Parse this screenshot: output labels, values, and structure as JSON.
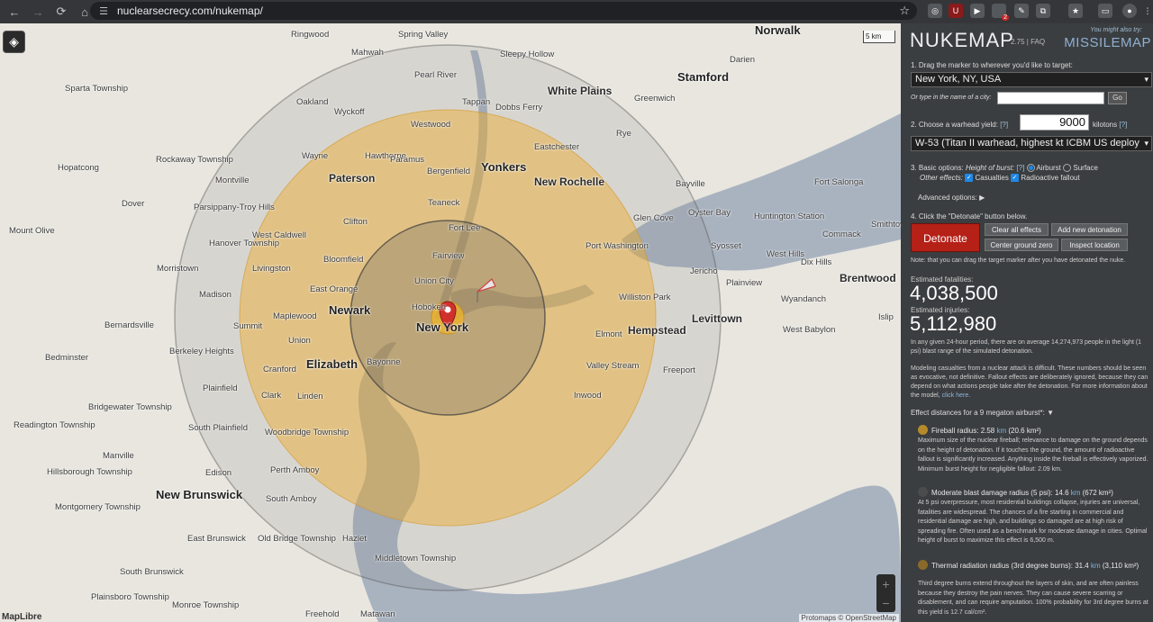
{
  "browser": {
    "url": "nuclearsecrecy.com/nukemap/",
    "ext_badge": "2"
  },
  "map": {
    "scale_label": "5 km",
    "logo": "MapLibre",
    "attribution": "Protomaps © OpenStreetMap",
    "zoom_in": "+",
    "zoom_out": "−",
    "places": [
      {
        "name": "Norwalk",
        "cls": "big"
      },
      {
        "name": "Stamford",
        "cls": "big"
      },
      {
        "name": "White Plains",
        "cls": "mid"
      },
      {
        "name": "Yonkers",
        "cls": "big"
      },
      {
        "name": "New Rochelle",
        "cls": "mid"
      },
      {
        "name": "Paterson",
        "cls": "mid"
      },
      {
        "name": "Newark",
        "cls": "big"
      },
      {
        "name": "New York",
        "cls": "big"
      },
      {
        "name": "Elizabeth",
        "cls": "big"
      },
      {
        "name": "Hempstead",
        "cls": "mid"
      },
      {
        "name": "Levittown",
        "cls": "mid"
      },
      {
        "name": "Brentwood",
        "cls": "mid"
      },
      {
        "name": "New Brunswick",
        "cls": "big"
      },
      {
        "name": "Ringwood",
        "cls": ""
      },
      {
        "name": "Spring Valley",
        "cls": ""
      },
      {
        "name": "Mahwah",
        "cls": ""
      },
      {
        "name": "Sleepy Hollow",
        "cls": ""
      },
      {
        "name": "Pearl River",
        "cls": ""
      },
      {
        "name": "Darien",
        "cls": ""
      },
      {
        "name": "Sparta Township",
        "cls": ""
      },
      {
        "name": "Oakland",
        "cls": ""
      },
      {
        "name": "Tappan",
        "cls": ""
      },
      {
        "name": "Greenwich",
        "cls": ""
      },
      {
        "name": "Wyckoff",
        "cls": ""
      },
      {
        "name": "Dobbs Ferry",
        "cls": ""
      },
      {
        "name": "Westwood",
        "cls": ""
      },
      {
        "name": "Rye",
        "cls": ""
      },
      {
        "name": "Hawthorne",
        "cls": ""
      },
      {
        "name": "Eastchester",
        "cls": ""
      },
      {
        "name": "Wayne",
        "cls": ""
      },
      {
        "name": "Paramus",
        "cls": ""
      },
      {
        "name": "Rockaway Township",
        "cls": ""
      },
      {
        "name": "Hopatcong",
        "cls": ""
      },
      {
        "name": "Bergenfield",
        "cls": ""
      },
      {
        "name": "Bayville",
        "cls": ""
      },
      {
        "name": "Montville",
        "cls": ""
      },
      {
        "name": "Fort Salonga",
        "cls": ""
      },
      {
        "name": "Dover",
        "cls": ""
      },
      {
        "name": "Teaneck",
        "cls": ""
      },
      {
        "name": "Parsippany-Troy Hills",
        "cls": ""
      },
      {
        "name": "Glen Cove",
        "cls": ""
      },
      {
        "name": "Oyster Bay",
        "cls": ""
      },
      {
        "name": "Huntington Station",
        "cls": ""
      },
      {
        "name": "Smithtown",
        "cls": ""
      },
      {
        "name": "Clifton",
        "cls": ""
      },
      {
        "name": "Fort Lee",
        "cls": ""
      },
      {
        "name": "Mount Olive",
        "cls": ""
      },
      {
        "name": "Hanover Township",
        "cls": ""
      },
      {
        "name": "West Caldwell",
        "cls": ""
      },
      {
        "name": "Commack",
        "cls": ""
      },
      {
        "name": "Port Washington",
        "cls": ""
      },
      {
        "name": "Syosset",
        "cls": ""
      },
      {
        "name": "West Hills",
        "cls": ""
      },
      {
        "name": "Fairview",
        "cls": ""
      },
      {
        "name": "Bloomfield",
        "cls": ""
      },
      {
        "name": "Dix Hills",
        "cls": ""
      },
      {
        "name": "Livingston",
        "cls": ""
      },
      {
        "name": "Jericho",
        "cls": ""
      },
      {
        "name": "Morristown",
        "cls": ""
      },
      {
        "name": "Union City",
        "cls": ""
      },
      {
        "name": "Plainview",
        "cls": ""
      },
      {
        "name": "East Orange",
        "cls": ""
      },
      {
        "name": "Madison",
        "cls": ""
      },
      {
        "name": "Williston Park",
        "cls": ""
      },
      {
        "name": "Wyandanch",
        "cls": ""
      },
      {
        "name": "Hoboken",
        "cls": ""
      },
      {
        "name": "Maplewood",
        "cls": ""
      },
      {
        "name": "Islip",
        "cls": ""
      },
      {
        "name": "Bernardsville",
        "cls": ""
      },
      {
        "name": "Summit",
        "cls": ""
      },
      {
        "name": "Elmont",
        "cls": ""
      },
      {
        "name": "West Babylon",
        "cls": ""
      },
      {
        "name": "Union",
        "cls": ""
      },
      {
        "name": "Berkeley Heights",
        "cls": ""
      },
      {
        "name": "Bedminster",
        "cls": ""
      },
      {
        "name": "Bayonne",
        "cls": ""
      },
      {
        "name": "Valley Stream",
        "cls": ""
      },
      {
        "name": "Freeport",
        "cls": ""
      },
      {
        "name": "Cranford",
        "cls": ""
      },
      {
        "name": "Plainfield",
        "cls": ""
      },
      {
        "name": "Clark",
        "cls": ""
      },
      {
        "name": "Linden",
        "cls": ""
      },
      {
        "name": "Inwood",
        "cls": ""
      },
      {
        "name": "Bridgewater Township",
        "cls": ""
      },
      {
        "name": "Readington Township",
        "cls": ""
      },
      {
        "name": "South Plainfield",
        "cls": ""
      },
      {
        "name": "Woodbridge Township",
        "cls": ""
      },
      {
        "name": "Manville",
        "cls": ""
      },
      {
        "name": "Edison",
        "cls": ""
      },
      {
        "name": "Perth Amboy",
        "cls": ""
      },
      {
        "name": "Hillsborough Township",
        "cls": ""
      },
      {
        "name": "South Amboy",
        "cls": ""
      },
      {
        "name": "Montgomery Township",
        "cls": ""
      },
      {
        "name": "East Brunswick",
        "cls": ""
      },
      {
        "name": "Old Bridge Township",
        "cls": ""
      },
      {
        "name": "Hazlet",
        "cls": ""
      },
      {
        "name": "Middletown Township",
        "cls": ""
      },
      {
        "name": "South Brunswick",
        "cls": ""
      },
      {
        "name": "Plainsboro Township",
        "cls": ""
      },
      {
        "name": "Monroe Township",
        "cls": ""
      },
      {
        "name": "Freehold",
        "cls": ""
      },
      {
        "name": "Matawan",
        "cls": ""
      }
    ]
  },
  "panel": {
    "title": "NUKEMAP",
    "version": "2.75 | FAQ",
    "you_might": "You might also try:",
    "missilemap": "MISSILEMAP",
    "step1": "1. Drag the marker to wherever you'd like to target:",
    "city_value": "New York, NY, USA",
    "or_type": "Or type in the name of a city:",
    "go_label": "Go",
    "step2": "2. Choose a warhead yield:",
    "help": "[?]",
    "yield_value": "9000",
    "yield_unit": "kilotons",
    "warhead_value": "W-53 (Titan II warhead, highest kt ICBM US deploy",
    "step3": "3. Basic options:",
    "height_of_burst": "Height of burst:",
    "airburst": "Airburst",
    "surface": "Surface",
    "other_effects": "Other effects:",
    "casualties": "Casualties",
    "fallout": "Radioactive fallout",
    "advanced": "Advanced options:",
    "step4": "4. Click the \"Detonate\" button below.",
    "detonate": "Detonate",
    "clear_effects": "Clear all effects",
    "add_detonation": "Add new detonation",
    "center_gz": "Center ground zero",
    "inspect": "Inspect location",
    "note": "Note: that you can drag the target marker after you have detonated the nuke.",
    "fatalities_label": "Estimated fatalities:",
    "fatalities": "4,038,500",
    "injuries_label": "Estimated injuries:",
    "injuries": "5,112,980",
    "in_any_given": "In any given 24-hour period, there are on average 14,274,973 people in the light (1 psi) blast range of the simulated detonation.",
    "modeling": "Modeling casualties from a nuclear attack is difficult. These numbers should be seen as evocative, not definitive. Fallout effects are deliberately ignored, because they can depend on what actions people take after the detonation. For more information about the model,",
    "click_here": "click here.",
    "effect_distances": "Effect distances for a 9 megaton airburst*:",
    "effects": [
      {
        "title": "Fireball radius: 2.58",
        "unit": "km",
        "area": "(20.6 km²)",
        "color": "#b58a2a",
        "desc": "Maximum size of the nuclear fireball; relevance to damage on the ground depends on the height of detonation. If it touches the ground, the amount of radioactive fallout is significantly increased. Anything inside the fireball is effectively vaporized. Minimum burst height for negligible fallout: 2.09 km."
      },
      {
        "title": "Moderate blast damage radius (5 psi): 14.6",
        "unit": "km",
        "area": "(672 km²)",
        "color": "#4a4c4e",
        "desc": "At 5 psi overpressure, most residential buildings collapse, injuries are universal, fatalities are widespread. The chances of a fire starting in commercial and residential damage are high, and buildings so damaged are at high risk of spreading fire. Often used as a benchmark for moderate damage in cities. Optimal height of burst to maximize this effect is 6,500 m."
      },
      {
        "title": "Thermal radiation radius (3rd degree burns): 31.4",
        "unit": "km",
        "area": "(3,110 km²)",
        "color": "#8a6a2a",
        "desc": "Third degree burns extend throughout the layers of skin, and are often painless because they destroy the pain nerves. They can cause severe scarring or disablement, and can require amputation. 100% probability for 3rd degree burns at this yield is 12.7 cal/cm²."
      }
    ]
  }
}
